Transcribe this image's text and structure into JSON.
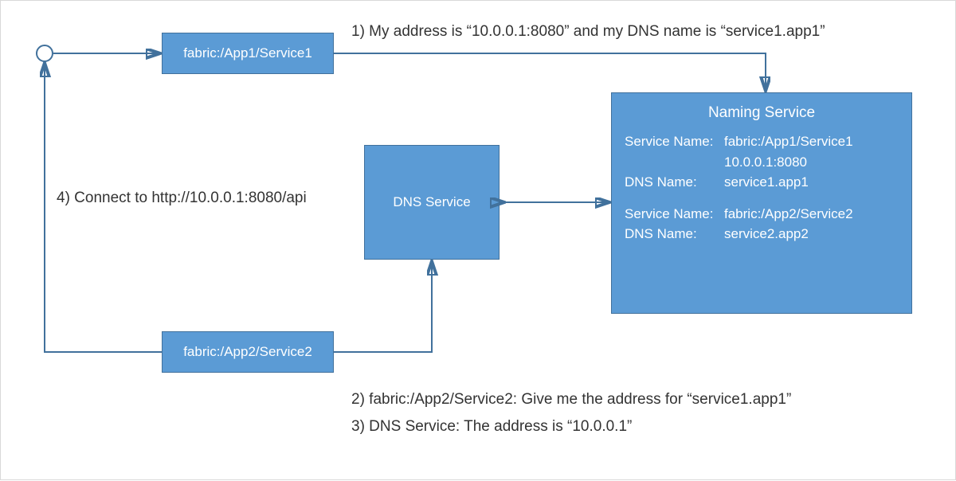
{
  "nodes": {
    "service1": {
      "label": "fabric:/App1/Service1"
    },
    "service2": {
      "label": "fabric:/App2/Service2"
    },
    "dns": {
      "label": "DNS Service"
    },
    "naming": {
      "title": "Naming Service",
      "entries": [
        {
          "serviceNameKey": "Service Name:",
          "serviceNameVal": "fabric:/App1/Service1",
          "addressVal": "10.0.0.1:8080",
          "dnsKey": "DNS Name:",
          "dnsVal": "service1.app1"
        },
        {
          "serviceNameKey": "Service Name:",
          "serviceNameVal": "fabric:/App2/Service2",
          "dnsKey": "DNS Name:",
          "dnsVal": "service2.app2"
        }
      ]
    }
  },
  "labels": {
    "step1": "1) My address is “10.0.0.1:8080” and my DNS name is “service1.app1”",
    "step2": "2) fabric:/App2/Service2: Give me the address for “service1.app1”",
    "step3": "3) DNS Service: The address is “10.0.0.1”",
    "step4": "4) Connect to http://10.0.0.1:8080/api"
  },
  "colors": {
    "boxFill": "#5b9bd5",
    "boxBorder": "#41719c",
    "text": "#333333"
  }
}
